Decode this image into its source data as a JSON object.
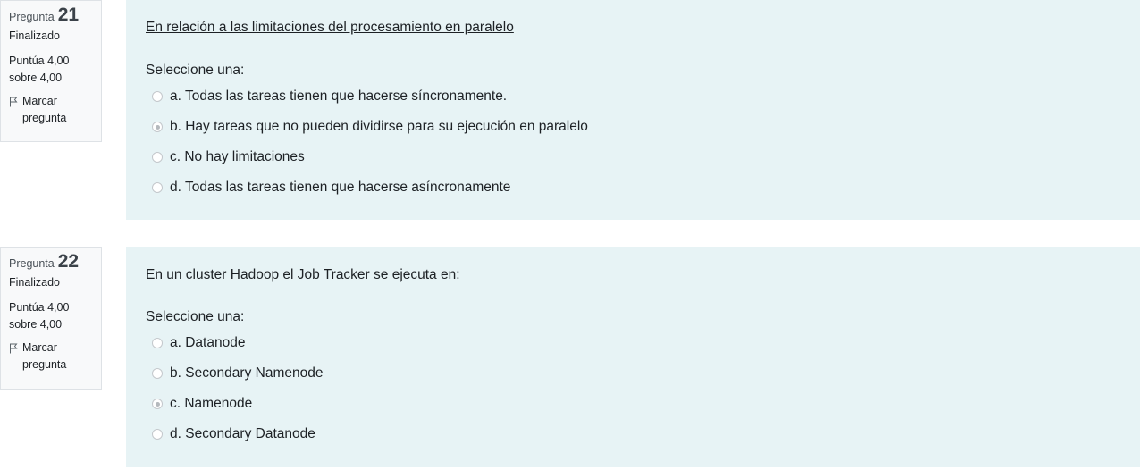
{
  "questions": [
    {
      "label": "Pregunta",
      "number": "21",
      "state": "Finalizado",
      "grade_line1": "Puntúa 4,00",
      "grade_line2": "sobre 4,00",
      "flag_line1": "Marcar",
      "flag_line2": "pregunta",
      "text": "En relación a las limitaciones del procesamiento en paralelo",
      "prompt": "Seleccione una:",
      "options": [
        {
          "label": "a. Todas las tareas tienen que hacerse síncronamente.",
          "selected": false
        },
        {
          "label": "b. Hay tareas que no pueden dividirse para su ejecución en paralelo",
          "selected": true
        },
        {
          "label": "c. No hay limitaciones",
          "selected": false
        },
        {
          "label": "d. Todas las tareas tienen que hacerse asíncronamente",
          "selected": false
        }
      ]
    },
    {
      "label": "Pregunta",
      "number": "22",
      "state": "Finalizado",
      "grade_line1": "Puntúa 4,00",
      "grade_line2": "sobre 4,00",
      "flag_line1": "Marcar",
      "flag_line2": "pregunta",
      "text": "En un cluster Hadoop el Job Tracker se ejecuta en:",
      "prompt": "Seleccione una:",
      "options": [
        {
          "label": "a. Datanode",
          "selected": false
        },
        {
          "label": "b. Secondary Namenode",
          "selected": false
        },
        {
          "label": "c. Namenode",
          "selected": true
        },
        {
          "label": "d. Secondary Datanode",
          "selected": false
        }
      ]
    }
  ],
  "colors": {
    "content_bg": "#e7f3f5",
    "info_bg": "#f8f9fa",
    "info_border": "#dee2e6",
    "text": "#1d2125"
  },
  "icons": {
    "flag": "flag-icon",
    "radio": "radio-icon"
  }
}
